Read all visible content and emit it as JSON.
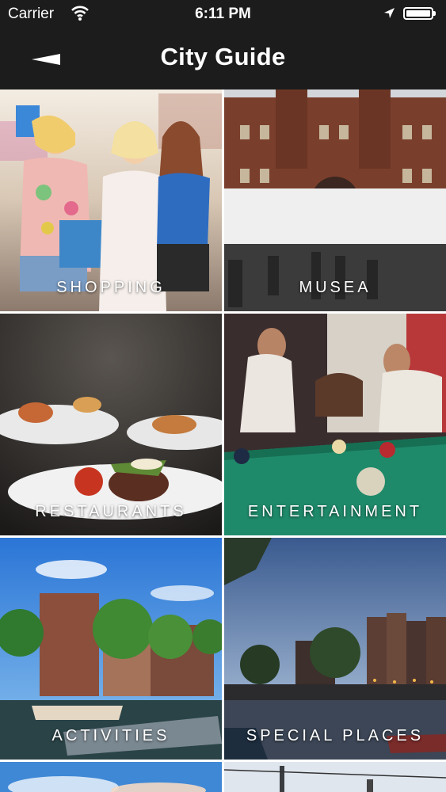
{
  "status_bar": {
    "carrier": "Carrier",
    "time": "6:11 PM"
  },
  "nav": {
    "title": "City Guide"
  },
  "categories": [
    {
      "label": "SHOPPING"
    },
    {
      "label": "MUSEA"
    },
    {
      "label": "RESTAURANTS"
    },
    {
      "label": "ENTERTAINMENT"
    },
    {
      "label": "ACTIVITIES"
    },
    {
      "label": "SPECIAL PLACES"
    }
  ],
  "colors": {
    "bar": "#1c1c1c",
    "text": "#ffffff",
    "pool_table": "#1f8a6a",
    "sky": "#3f8fd8"
  }
}
